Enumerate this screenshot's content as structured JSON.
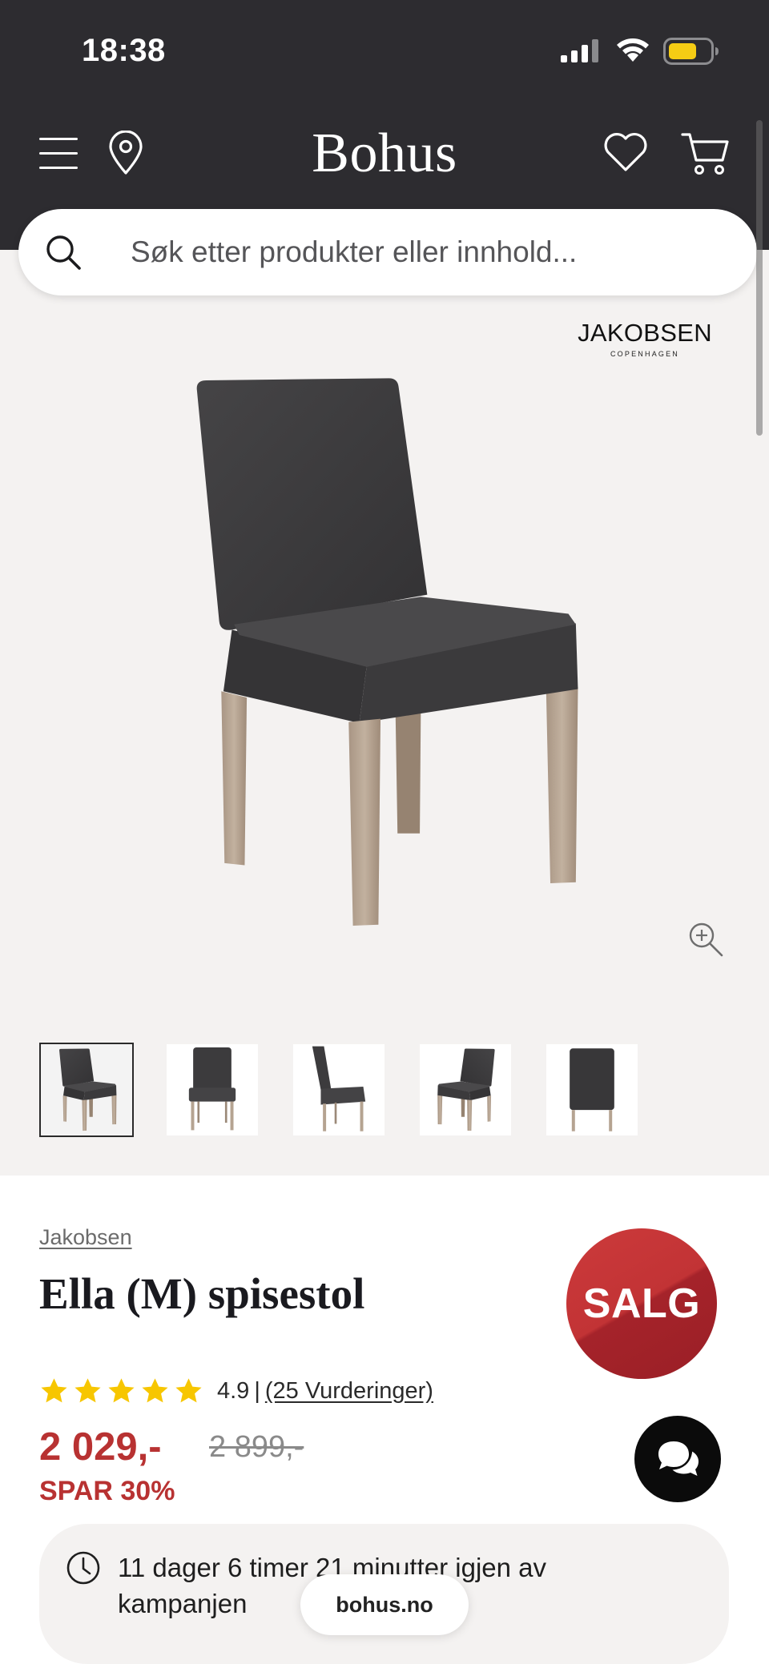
{
  "status_bar": {
    "time": "18:38",
    "icons": [
      "signal-icon",
      "wifi-icon",
      "battery-icon"
    ]
  },
  "header": {
    "title": "Bohus",
    "icons": [
      "menu-icon",
      "location-pin-icon",
      "heart-icon",
      "cart-icon"
    ]
  },
  "search": {
    "placeholder": "Søk etter produkter eller innhold..."
  },
  "gallery": {
    "brand_logo": "JAKOBSEN",
    "brand_logo_sub": "COPENHAGEN",
    "thumbnails": [
      {
        "selected": true
      },
      {
        "selected": false
      },
      {
        "selected": false
      },
      {
        "selected": false
      },
      {
        "selected": false
      }
    ]
  },
  "product": {
    "brand": "Jakobsen",
    "title": "Ella (M) spisestol",
    "badge": "SALG",
    "rating": {
      "stars_filled": 5,
      "stars_total": 5,
      "value": "4.9",
      "separator": "|",
      "count_label": "(25 Vurderinger)"
    },
    "price": {
      "current": "2 029,-",
      "original": "2 899,-",
      "saving": "SPAR 30%"
    }
  },
  "campaign": {
    "countdown": "11 dager 6 timer 21 minutter igjen av kampanjen"
  },
  "browser": {
    "domain": "bohus.no"
  },
  "colors": {
    "header_bg": "#2d2c30",
    "gallery_bg": "#f4f2f1",
    "price_red": "#b83232",
    "star_yellow": "#f7c600",
    "battery_fill": "#f5cc14"
  }
}
